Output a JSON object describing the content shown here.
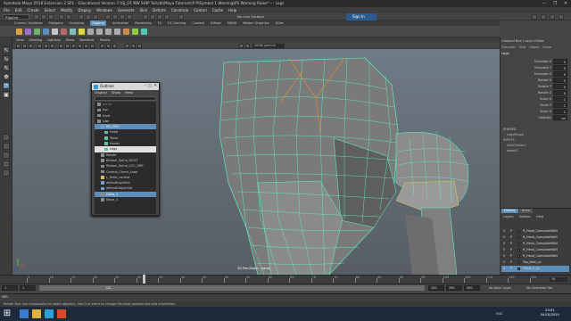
{
  "window": {
    "title": "Autodesk Maya 2018 Extension 2 SP1 - Educational Version: F:\\SJ_OF NW SHIP Tut\\cbl\\Maya Tutorials\\P-P\\Symbol 1 Warning\\PS Warning Rules* --- Legs",
    "controls": [
      "—",
      "❐",
      "✕"
    ]
  },
  "main_menu": [
    "File",
    "Edit",
    "Create",
    "Select",
    "Modify",
    "Display",
    "Windows",
    "Generate",
    "Skin",
    "Deform",
    "Constrain",
    "Control",
    "Cache",
    "Help"
  ],
  "status_line": {
    "menu_set": "Rigging",
    "live_surface": "No Live Surface",
    "sign_in": "Sign In"
  },
  "shelf_tabs": [
    "Curves / Surfaces",
    "Polygons",
    "Sculpting",
    "Rigging",
    "Animation",
    "Rendering",
    "FX",
    "FX Caching",
    "Custom",
    "Bifrost",
    "MASH",
    "Motion Graphics",
    "XGen"
  ],
  "shelf_active_tab": "Rigging",
  "panel_menu": [
    "View",
    "Shading",
    "Lighting",
    "Show",
    "Renderer",
    "Panels"
  ],
  "camera_field": "sRGB gamma",
  "viewport": {
    "camera_label": "2D Pan/Zoom : persp"
  },
  "outliner": {
    "title": "Outliner",
    "menu": [
      "Display",
      "Show",
      "Help"
    ],
    "items": [
      {
        "label": "persp",
        "indent": 0,
        "state": "dim"
      },
      {
        "label": "top",
        "indent": 0,
        "state": "normal"
      },
      {
        "label": "front",
        "indent": 0,
        "state": "normal"
      },
      {
        "label": "side",
        "indent": 0,
        "state": "normal"
      },
      {
        "label": "RG_GEO",
        "indent": 0,
        "state": "sel"
      },
      {
        "label": "Head",
        "indent": 1,
        "state": "normal"
      },
      {
        "label": "Torso",
        "indent": 1,
        "state": "normal"
      },
      {
        "label": "Hands",
        "indent": 1,
        "state": "normal"
      },
      {
        "label": "Legs",
        "indent": 1,
        "state": "sel"
      },
      {
        "label": "Rotate",
        "indent": 0,
        "state": "normal"
      },
      {
        "label": "Ribbon_Spine_ROOT",
        "indent": 0,
        "state": "normal"
      },
      {
        "label": "Ribbon_Spine_LOC_GRP",
        "indent": 0,
        "state": "normal"
      },
      {
        "label": "Control_Check_Loop",
        "indent": 0,
        "state": "normal"
      },
      {
        "label": "L_Helix_control",
        "indent": 0,
        "state": "normal"
      },
      {
        "label": "defaultLightSet",
        "indent": 0,
        "state": "normal"
      },
      {
        "label": "defaultObjectSet",
        "indent": 0,
        "state": "normal"
      },
      {
        "label": "Deep_1",
        "indent": 0,
        "state": "sel"
      },
      {
        "label": "Maya_1",
        "indent": 0,
        "state": "normal"
      }
    ]
  },
  "channel_box": {
    "title": "Channel Box / Layer Editor",
    "tabs": [
      "Channels",
      "Edit",
      "Object",
      "Show"
    ],
    "object_name": "Legs",
    "attributes": [
      {
        "label": "Translate X",
        "value": "0"
      },
      {
        "label": "Translate Y",
        "value": "0"
      },
      {
        "label": "Translate Z",
        "value": "0"
      },
      {
        "label": "Rotate X",
        "value": "0"
      },
      {
        "label": "Rotate Y",
        "value": "0"
      },
      {
        "label": "Rotate Z",
        "value": "0"
      },
      {
        "label": "Scale X",
        "value": "1"
      },
      {
        "label": "Scale Y",
        "value": "1"
      },
      {
        "label": "Scale Z",
        "value": "1"
      },
      {
        "label": "Visibility",
        "value": "on"
      }
    ],
    "shapes_header": "SHAPES",
    "shapes": [
      "LegsShape"
    ],
    "inputs_header": "INPUTS",
    "inputs": [
      "skinCluster1",
      "tweak2"
    ]
  },
  "layer_editor": {
    "tabs": [
      "Display",
      "Anim"
    ],
    "menu": [
      "Layers",
      "Options",
      "Help"
    ],
    "layers": [
      {
        "v": "V",
        "p": "P",
        "name": "R_Head_ComplateMAN",
        "sel": false
      },
      {
        "v": "V",
        "p": "P",
        "name": "R_Head_ComplateMAN",
        "sel": false
      },
      {
        "v": "V",
        "p": "P",
        "name": "R_Head_ComplateMAN",
        "sel": false
      },
      {
        "v": "V",
        "p": "P",
        "name": "R_Head_ComplateMAN",
        "sel": false
      },
      {
        "v": "V",
        "p": "P",
        "name": "R_Head_ComplateMAN",
        "sel": false
      },
      {
        "v": "V",
        "p": "P",
        "name": "Top_Web_lyr",
        "sel": false
      },
      {
        "v": "V",
        "p": "P",
        "name": "Head_G_lyr",
        "sel": true
      }
    ]
  },
  "timeline": {
    "ticks": [
      "5",
      "10",
      "15",
      "20",
      "25",
      "30",
      "35",
      "40",
      "45",
      "50",
      "55",
      "60",
      "65",
      "70",
      "75",
      "80",
      "85",
      "90",
      "95",
      "100",
      "105",
      "110",
      "115",
      "120"
    ],
    "current_frame": "15",
    "frame_field": "15"
  },
  "range": {
    "start": "1",
    "inner_start": "1",
    "range_label": "120",
    "end": "120",
    "end2": "200",
    "end3": "200",
    "anim_layer": "No Anim Layer",
    "character_set": "No Character Set"
  },
  "command_line": {
    "label": "MEL"
  },
  "help_line": "Rotate Tool: Use manipulator to rotate object(s). Use D or Insert to change the pivot position and axis orientation.",
  "taskbar": {
    "clock_time": "23:01",
    "clock_date": "04/10/2019",
    "tray": "ENG"
  }
}
